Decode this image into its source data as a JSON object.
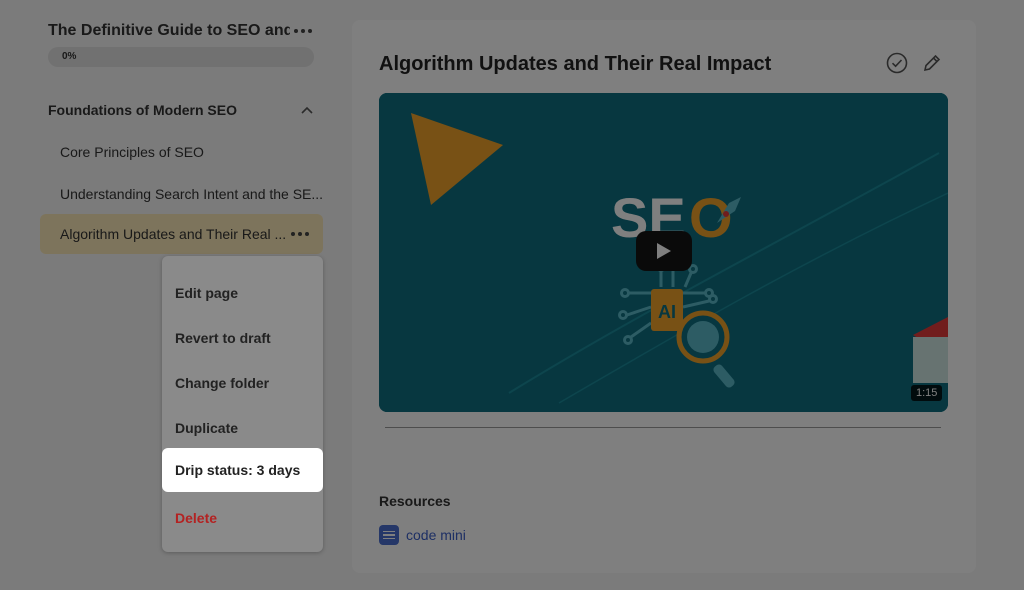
{
  "sidebar": {
    "course_title": "The Definitive Guide to SEO and ...",
    "progress": {
      "label": "0%",
      "value": 0
    },
    "folder": {
      "title": "Foundations of Modern SEO"
    },
    "lessons": [
      {
        "label": "Core Principles of SEO"
      },
      {
        "label": "Understanding Search Intent and the SE..."
      },
      {
        "label": "Algorithm Updates and Their Real ..."
      }
    ]
  },
  "context_menu": {
    "items": [
      {
        "label": "Edit page"
      },
      {
        "label": "Revert to draft"
      },
      {
        "label": "Change folder"
      },
      {
        "label": "Duplicate"
      },
      {
        "label": "Drip status: 3 days"
      },
      {
        "label": "Delete"
      }
    ]
  },
  "main": {
    "lesson_title": "Algorithm Updates and Their Real Impact",
    "video": {
      "thumbnail_text_1": "SE",
      "thumbnail_text_2": "O",
      "chip_text": "AI",
      "duration": "1:15"
    },
    "resources": {
      "title": "Resources",
      "items": [
        {
          "label": "code mini",
          "icon": "document-icon"
        }
      ]
    }
  },
  "colors": {
    "active_lesson_bg": "#fbe9b8",
    "video_bg": "#0e6f80",
    "accent_orange": "#f0a32a",
    "danger": "#b32222",
    "link": "#3b5ec8"
  }
}
